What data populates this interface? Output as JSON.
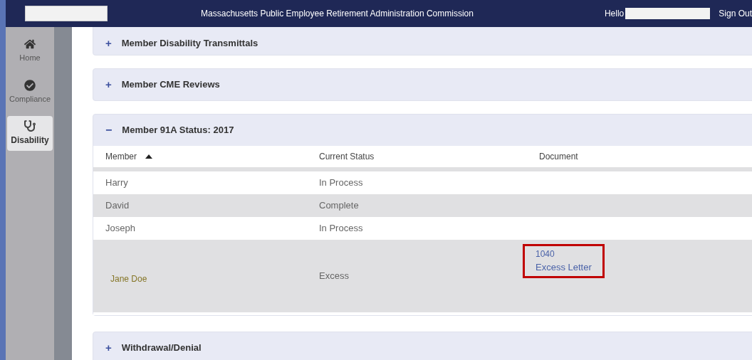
{
  "header": {
    "title": "Massachusetts Public Employee Retirement Administration Commission",
    "greeting": "Hello",
    "sign_out": "Sign Out"
  },
  "sidebar": {
    "items": [
      {
        "label": "Home",
        "kind": "home",
        "selected": false
      },
      {
        "label": "Compliance",
        "kind": "check",
        "selected": false
      },
      {
        "label": "Disability",
        "kind": "stethoscope",
        "selected": true
      }
    ]
  },
  "panels": [
    {
      "toggle": "+",
      "title": "Member Disability Transmittals",
      "expanded": false
    },
    {
      "toggle": "+",
      "title": "Member CME Reviews",
      "expanded": false
    },
    {
      "toggle": "−",
      "title": "Member 91A Status: 2017",
      "expanded": true,
      "table": {
        "columns": [
          {
            "label": "Member",
            "sorted": true
          },
          {
            "label": "Current Status",
            "sorted": false
          },
          {
            "label": "Document",
            "sorted": false
          }
        ],
        "rows": [
          {
            "member": "Harry",
            "status": "In Process",
            "highlighted": false
          },
          {
            "member": "David",
            "status": "Complete",
            "highlighted": false
          },
          {
            "member": "Joseph",
            "status": "In Process",
            "highlighted": false
          },
          {
            "member": "Jane Doe",
            "status": "Excess",
            "highlighted": true,
            "document_links": [
              "1040",
              "Excess Letter"
            ]
          }
        ]
      }
    },
    {
      "toggle": "+",
      "title": "Withdrawal/Denial",
      "expanded": false
    }
  ]
}
